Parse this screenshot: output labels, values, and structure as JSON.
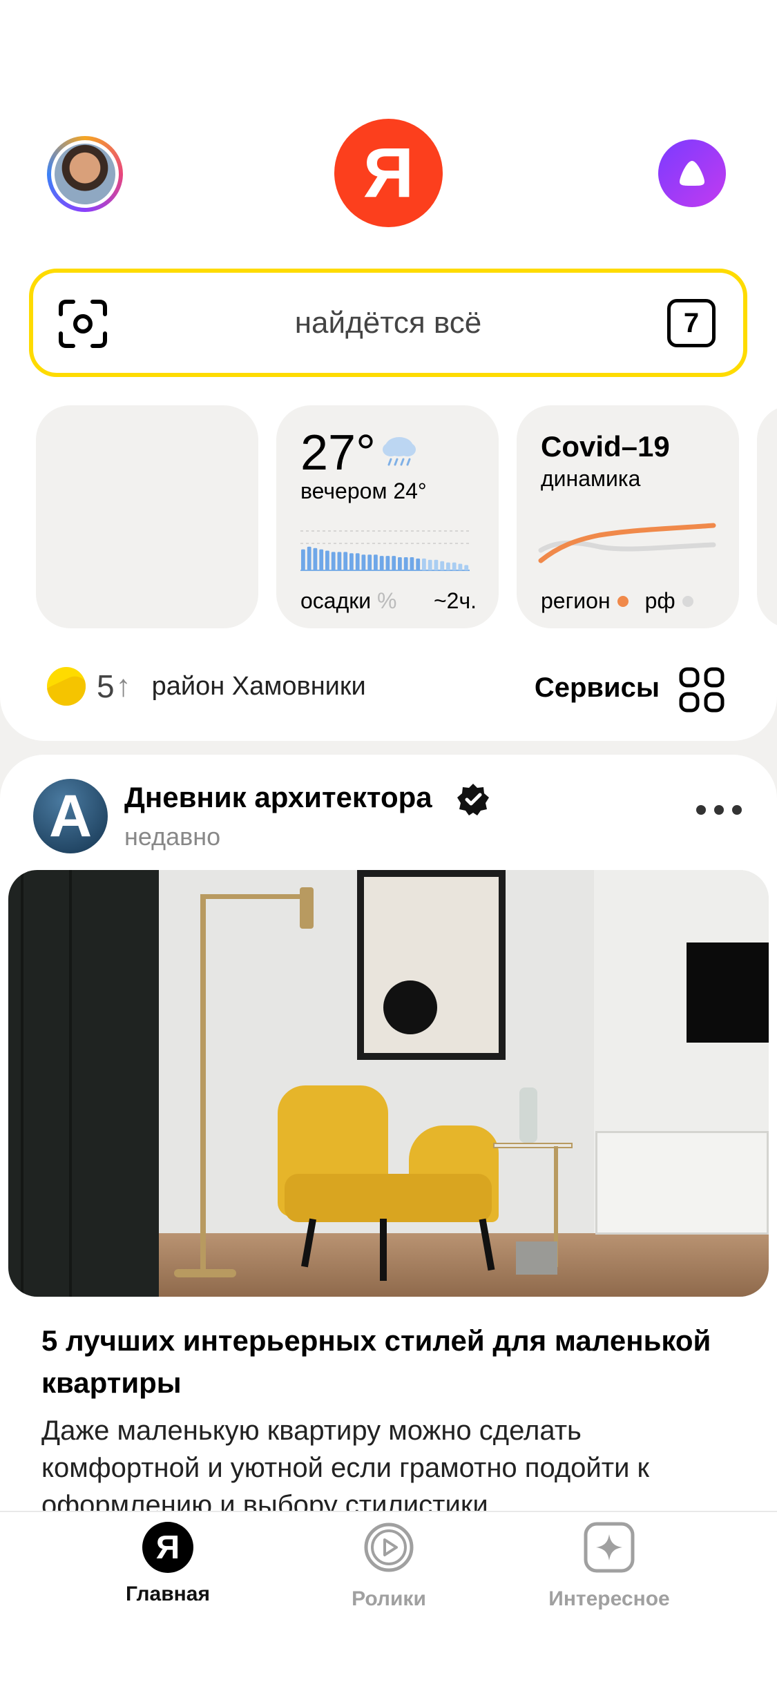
{
  "header": {
    "logo_letter": "Я",
    "avatar_icon": "user-avatar",
    "alice_icon": "alice-icon"
  },
  "search": {
    "placeholder": "найдётся всё",
    "badge": "7",
    "camera_icon": "camera-scan-icon"
  },
  "widgets": {
    "weather": {
      "temperature": "27°",
      "evening": "вечером 24°",
      "precip_label": "осадки",
      "precip_pct": "%",
      "time": "~2ч.",
      "precip_level": [
        0.8,
        0.9,
        0.85,
        0.8,
        0.75,
        0.7,
        0.7,
        0.7,
        0.65,
        0.65,
        0.6,
        0.6,
        0.6,
        0.55,
        0.55,
        0.55,
        0.5,
        0.5,
        0.5,
        0.45,
        0.45,
        0.4,
        0.4,
        0.35,
        0.3,
        0.3,
        0.25,
        0.2
      ]
    },
    "covid": {
      "title": "Covid–19",
      "subtitle": "динамика",
      "legend_region": "регион",
      "legend_rf": "рф",
      "region_color": "#f0894a",
      "rf_color": "#d9d9d9"
    }
  },
  "status": {
    "uv_value": "5",
    "uv_arrow": "↑",
    "district": "район Хамовники",
    "services_label": "Сервисы"
  },
  "post": {
    "channel_letter": "A",
    "channel_name": "Дневник архитектора",
    "time": "недавно",
    "title": "5 лучших интерьерных стилей для маленькой квартиры",
    "description": "Даже маленькую квартиру можно сделать комфортной и уютной если грамотно подойти к оформлению и выбору стилистики"
  },
  "tabbar": {
    "home": "Главная",
    "reels": "Ролики",
    "interest": "Интересное",
    "home_logo": "Я"
  },
  "colors": {
    "brand_red": "#fc3f1d",
    "search_border": "#fedb00",
    "alice_purple": "#8a3ffc"
  }
}
